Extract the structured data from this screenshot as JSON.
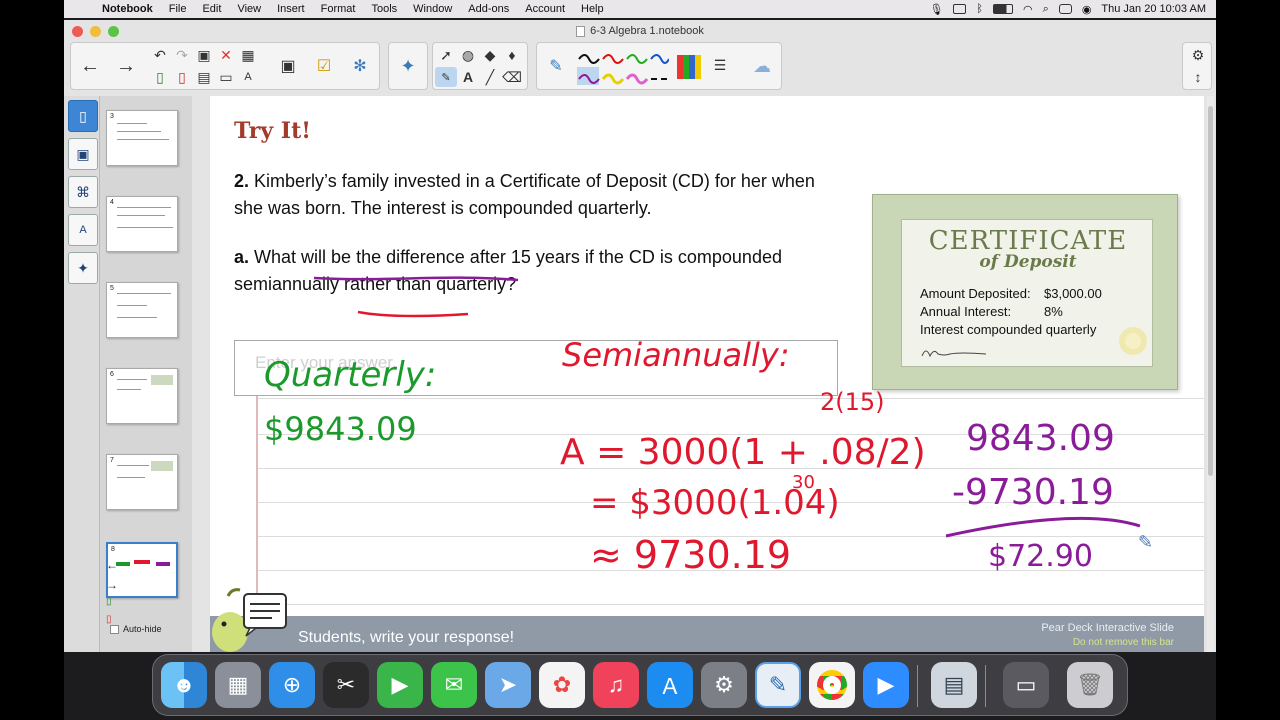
{
  "menubar": {
    "app_name": "Notebook",
    "items": [
      "File",
      "Edit",
      "View",
      "Insert",
      "Format",
      "Tools",
      "Window",
      "Add-ons",
      "Account",
      "Help"
    ],
    "clock": "Thu Jan 20  10:03 AM"
  },
  "window": {
    "title": "6-3 Algebra 1.notebook"
  },
  "sidebar": {
    "pages": [
      "3",
      "4",
      "5",
      "6",
      "7",
      "8"
    ],
    "current_page": "8",
    "autohide_label": "Auto-hide"
  },
  "slide": {
    "heading": "Try It!",
    "q2_num": "2.",
    "q2_text": "Kimberly’s family invested in a Certificate of Deposit (CD) for her when she was born. The interest is compounded quarterly.",
    "qa_num": "a.",
    "qa_text": "What will be the difference after 15 years if the CD is compounded semiannually rather than quarterly?",
    "answer_placeholder": "Enter your answer."
  },
  "certificate": {
    "title": "CERTIFICATE",
    "subtitle": "of Deposit",
    "amount_label": "Amount Deposited:",
    "amount_value": "$3,000.00",
    "rate_label": "Annual Interest:",
    "rate_value": "8%",
    "compound_text": "Interest compounded quarterly"
  },
  "handwriting": {
    "quarterly_label": "Quarterly:",
    "quarterly_value": "$9843.09",
    "semi_label": "Semiannually:",
    "formula": "A = 3000(1 + .08/2)",
    "exponent1": "2(15)",
    "step2": "= $3000(1.04)",
    "exponent2": "30",
    "step3": "≈ 9730.19",
    "sub_top": "9843.09",
    "sub_bottom": "-9730.19",
    "difference": "$72.90"
  },
  "pear_deck": {
    "message": "Students, write your response!",
    "title": "Pear Deck Interactive Slide",
    "note": "Do not remove this bar"
  },
  "colors": {
    "heading": "#a33a2a",
    "ink_green": "#1a9a2a",
    "ink_red": "#e0182e",
    "ink_purple": "#8a1c9a",
    "selection": "#3d86d6"
  }
}
